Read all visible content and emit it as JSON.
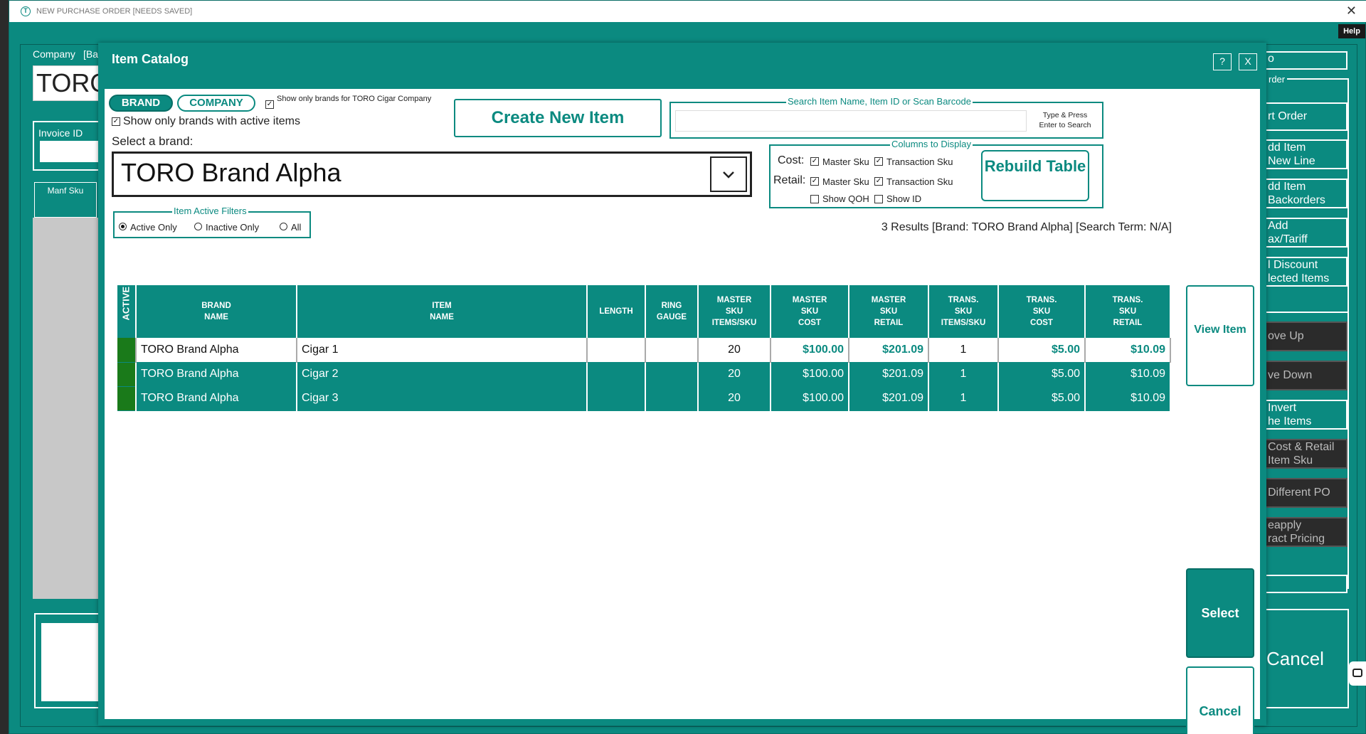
{
  "window": {
    "title": "NEW PURCHASE ORDER [NEEDS SAVED]",
    "close": "✕",
    "help": "Help"
  },
  "background": {
    "company_label": "Company",
    "company_bracket": "[Ba",
    "toro": "TORO",
    "invoice_label": "Invoice ID",
    "manf_sku": "Manf Sku",
    "right_buttons": [
      "rt Order",
      "dd Item\nNew Line",
      "dd Item\nBackorders",
      "Add\nax/Tariff",
      "l Discount\nlected Items",
      "ove Up",
      "ve Down",
      "Invert\nhe Items",
      "Cost & Retail\nItem Sku",
      "Different PO",
      "eapply\nract Pricing",
      "Cancel"
    ],
    "order_label": "rder",
    "top_right": "o"
  },
  "modal": {
    "title": "Item Catalog",
    "help_btn": "?",
    "close_btn": "X",
    "toggle": {
      "brand": "BRAND",
      "company": "COMPANY"
    },
    "show_only_toro": "Show only brands for TORO Cigar Company",
    "show_only_active": "Show only brands with active items",
    "select_brand_label": "Select a brand:",
    "selected_brand": "TORO Brand Alpha",
    "create_new_item": "Create New Item",
    "search": {
      "legend": "Search Item Name, Item ID or Scan Barcode",
      "value": "",
      "hint_line1": "Type & Press",
      "hint_line2": "Enter to Search"
    },
    "columns_display": {
      "legend": "Columns to Display",
      "cost_label": "Cost:",
      "retail_label": "Retail:",
      "master_sku": "Master Sku",
      "transaction_sku": "Transaction Sku",
      "show_qoh": "Show QOH",
      "show_id": "Show ID",
      "rebuild": "Rebuild Table"
    },
    "filters": {
      "legend": "Item Active Filters",
      "active_only": "Active Only",
      "inactive_only": "Inactive Only",
      "all": "All",
      "selected": "Active Only"
    },
    "results_text": "3 Results [Brand: TORO Brand Alpha] [Search Term: N/A]",
    "table": {
      "headers": [
        "ACTIVE",
        "BRAND\nNAME",
        "ITEM\nNAME",
        "LENGTH",
        "RING\nGAUGE",
        "MASTER\nSKU\nITEMS/SKU",
        "MASTER\nSKU\nCOST",
        "MASTER\nSKU\nRETAIL",
        "TRANS.\nSKU\nITEMS/SKU",
        "TRANS.\nSKU\nCOST",
        "TRANS.\nSKU\nRETAIL"
      ],
      "rows": [
        [
          "",
          "TORO Brand Alpha",
          "Cigar 1",
          "",
          "",
          "20",
          "$100.00",
          "$201.09",
          "1",
          "$5.00",
          "$10.09"
        ],
        [
          "",
          "TORO Brand Alpha",
          "Cigar 2",
          "",
          "",
          "20",
          "$100.00",
          "$201.09",
          "1",
          "$5.00",
          "$10.09"
        ],
        [
          "",
          "TORO Brand Alpha",
          "Cigar 3",
          "",
          "",
          "20",
          "$100.00",
          "$201.09",
          "1",
          "$5.00",
          "$10.09"
        ]
      ]
    },
    "view_item": "View Item",
    "select": "Select",
    "cancel": "Cancel"
  }
}
